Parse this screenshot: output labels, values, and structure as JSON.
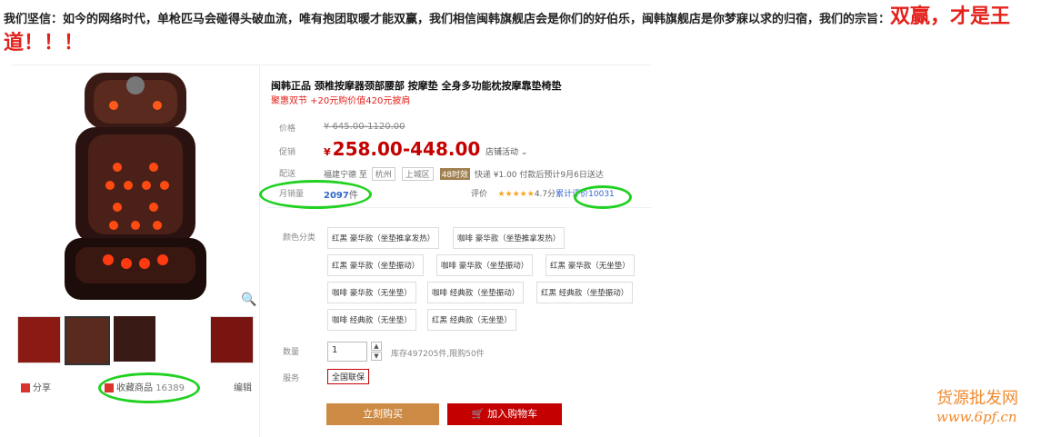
{
  "banner": {
    "text": "我们坚信：如今的网络时代，单枪匹马会碰得头破血流，唯有抱团取暖才能双赢，我们相信闽韩旗舰店会是你们的好伯乐，闽韩旗舰店是你梦寐以求的归宿，我们的宗旨：",
    "highlight": "双赢，才是王道！！！"
  },
  "product": {
    "title": "闽韩正品 颈椎按摩器颈部腰部 按摩垫 全身多功能枕按摩靠垫椅垫",
    "promo": "聚惠双节 +20元购价值420元披肩",
    "price_label": "价格",
    "orig_price": "645.00-1120.00",
    "promo_label": "促销",
    "currency": "¥",
    "cur_price": "258.00-448.00",
    "activity": "店铺活动",
    "ship_label": "配送",
    "ship_from": "福建宁德",
    "ship_to_word": "至",
    "ship_city": "杭州",
    "ship_district": "上城区",
    "ship_tag": "48时效",
    "ship_fee": "快递 ¥1.00 付款后预计9月6日送达",
    "sales_label": "月销量",
    "sales_value": "2097",
    "sales_unit": "件",
    "rating_label": "评价",
    "rating_stars": "★★★★★",
    "rating_score": "4.7分",
    "rating_count": "累计评价10031",
    "color_label": "颜色分类",
    "options": [
      "红黑 豪华款（坐垫推拿发热）",
      "咖啡 豪华款（坐垫推拿发热）",
      "红黑 豪华款（坐垫振动）",
      "咖啡 豪华款（坐垫振动）",
      "红黑 豪华款（无坐垫）",
      "咖啡 豪华款（无坐垫）",
      "咖啡 经典款（坐垫振动）",
      "红黑 经典款（坐垫振动）",
      "咖啡 经典款（无坐垫）",
      "红黑 经典款（无坐垫）"
    ],
    "qty_label": "数量",
    "qty_value": "1",
    "stock": "库存497205件,限购50件",
    "service_label": "服务",
    "service": "全国联保",
    "buy_label": "立刻购买",
    "cart_label": "加入购物车"
  },
  "gallery": {
    "share": "分享",
    "collect": "收藏商品",
    "collect_count": "16389",
    "edit": "编辑"
  },
  "watermark": {
    "line1": "货源批发网",
    "line2": "www.6pf.cn"
  },
  "colors": {
    "accent": "#c40000",
    "buy": "#cd8a44",
    "highlight": "#21d121"
  }
}
